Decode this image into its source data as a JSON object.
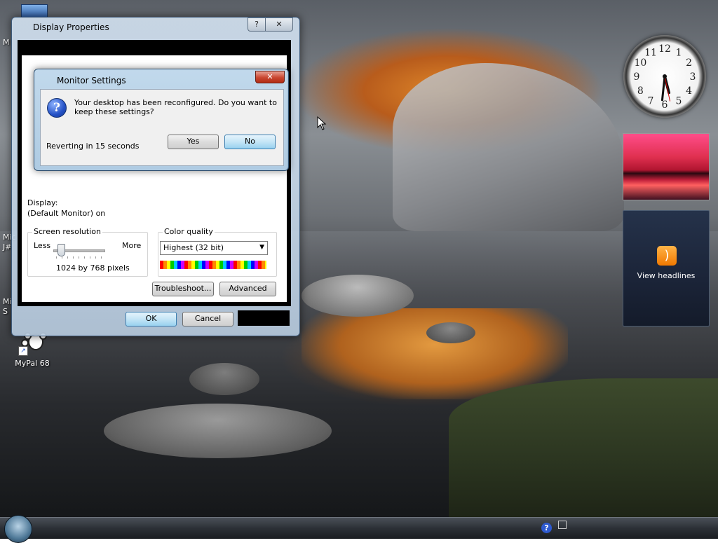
{
  "desktop": {
    "icon": {
      "label": "MyPal 68"
    },
    "edge_labels": [
      "M",
      "Mic",
      "J#",
      "Mi",
      "S"
    ]
  },
  "display_properties": {
    "title": "Display Properties",
    "help_glyph": "?",
    "close_glyph": "✕",
    "display_label": "Display:",
    "display_value": "(Default Monitor) on",
    "screen_resolution": {
      "title": "Screen resolution",
      "less": "Less",
      "more": "More",
      "value": "1024 by 768 pixels",
      "slider_fraction": 0.1
    },
    "color_quality": {
      "title": "Color quality",
      "selected": "Highest (32 bit)"
    },
    "troubleshoot_label": "Troubleshoot...",
    "advanced_label": "Advanced",
    "ok_label": "OK",
    "cancel_label": "Cancel"
  },
  "monitor_settings": {
    "title": "Monitor Settings",
    "close_glyph": "✕",
    "question_glyph": "?",
    "message": "Your desktop has been reconfigured.  Do you want to keep these settings?",
    "countdown": "Reverting in 15 seconds",
    "yes_label": "Yes",
    "no_label": "No"
  },
  "sidebar": {
    "clock": {
      "numerals": [
        "12",
        "1",
        "2",
        "3",
        "4",
        "5",
        "6",
        "7",
        "8",
        "9",
        "10",
        "11"
      ],
      "hour": 5,
      "minute": 31,
      "second": 28
    },
    "feed": {
      "label": "View headlines",
      "icon": "rss-icon"
    }
  },
  "taskbar": {
    "help_glyph": "?"
  },
  "colors": {
    "dialog_close": "#c94630",
    "default_button": "#98d1ef",
    "rss": "#f07800"
  }
}
